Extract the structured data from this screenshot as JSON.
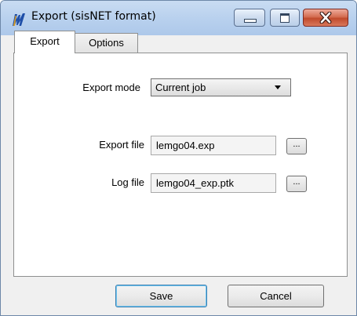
{
  "window": {
    "title": "Export (sisNET format)",
    "icons": {
      "app": "sisnet-app-icon",
      "minimize": "minimize-icon",
      "maximize": "maximize-icon",
      "close": "close-icon"
    }
  },
  "tabs": [
    {
      "label": "Export",
      "selected": true
    },
    {
      "label": "Options",
      "selected": false
    }
  ],
  "export_tab": {
    "export_mode": {
      "label": "Export mode",
      "value": "Current job",
      "icon": "dropdown-arrow-icon"
    },
    "export_file": {
      "label": "Export file",
      "value": "lemgo04.exp",
      "browse_label": "..."
    },
    "log_file": {
      "label": "Log file",
      "value": "lemgo04_exp.ptk",
      "browse_label": "..."
    }
  },
  "buttons": {
    "save": "Save",
    "cancel": "Cancel"
  },
  "colors": {
    "titlebar": "#b9d1ee",
    "close_button": "#c14a2c",
    "default_button_border": "#3c7fb1"
  }
}
